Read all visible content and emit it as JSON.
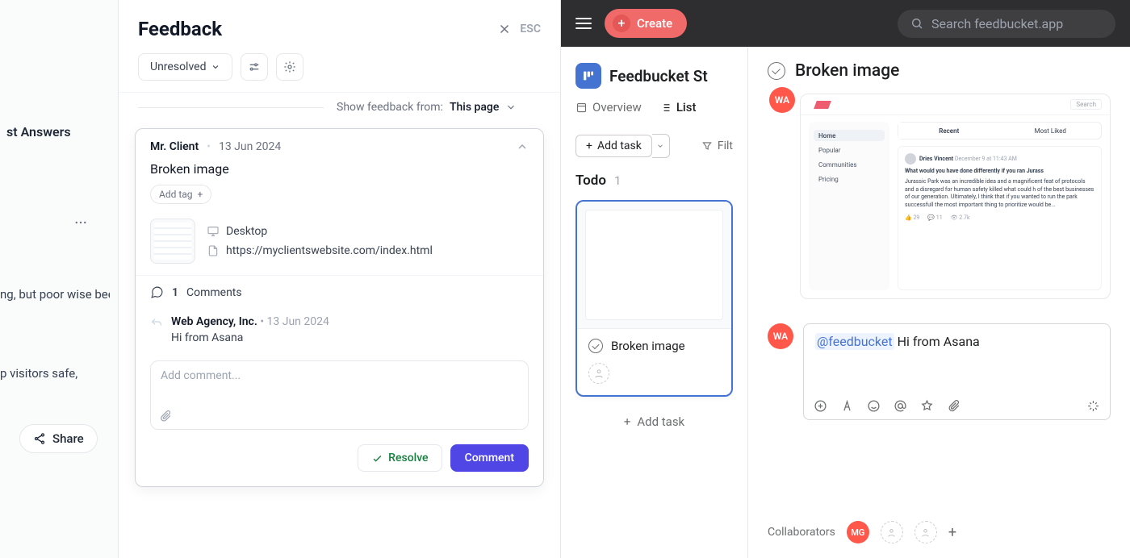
{
  "left": {
    "answers_label": "st Answers",
    "snippet1": "ng, but poor\nwise been one",
    "snippet2": "p visitors safe,",
    "share_label": "Share"
  },
  "feedback": {
    "title": "Feedback",
    "esc_label": "ESC",
    "status_label": "Unresolved",
    "filter_from_label": "Show feedback from:",
    "filter_value": "This page",
    "card": {
      "author": "Mr. Client",
      "date": "13 Jun 2024",
      "title": "Broken image",
      "add_tag_label": "Add tag",
      "platform": "Desktop",
      "url": "https://myclientswebsite.com/index.html",
      "comments_count": "1",
      "comments_label": "Comments",
      "reply": {
        "author": "Web Agency, Inc.",
        "date": "13 Jun 2024",
        "text": "Hi from Asana"
      },
      "comment_placeholder": "Add comment...",
      "resolve_label": "Resolve",
      "comment_btn_label": "Comment"
    }
  },
  "asana": {
    "create_label": "Create",
    "search_placeholder": "Search feedbucket.app",
    "project_name": "Feedbucket St",
    "tabs": {
      "overview": "Overview",
      "list": "List"
    },
    "add_task_label": "Add task",
    "filter_label": "Filt",
    "column": {
      "title": "Todo",
      "count": "1"
    },
    "task_card_title": "Broken image",
    "add_task_link": "Add task",
    "detail": {
      "title": "Broken image",
      "wa_initials": "WA",
      "comment_mention": "@feedbucket",
      "comment_text": " Hi from Asana",
      "collaborators_label": "Collaborators",
      "mg_initials": "MG",
      "preview": {
        "search": "Search",
        "nav": [
          "Home",
          "Popular",
          "Communities",
          "Pricing"
        ],
        "tabs": [
          "Recent",
          "Most Liked"
        ],
        "author": "Dries Vincent",
        "date": "December 9 at 11:43 AM",
        "q": "What would you have done differently if you ran Jurass",
        "body": "Jurassic Park was an incredible idea and a magnificent feat of protocols and a disregard for human safety killed what could h of the best businesses of our generation. Ultimately, I think that if you wanted to run the park successfull the most important thing to prioritize would be...",
        "likes": "29",
        "comments": "11",
        "views": "2.7k"
      }
    }
  }
}
